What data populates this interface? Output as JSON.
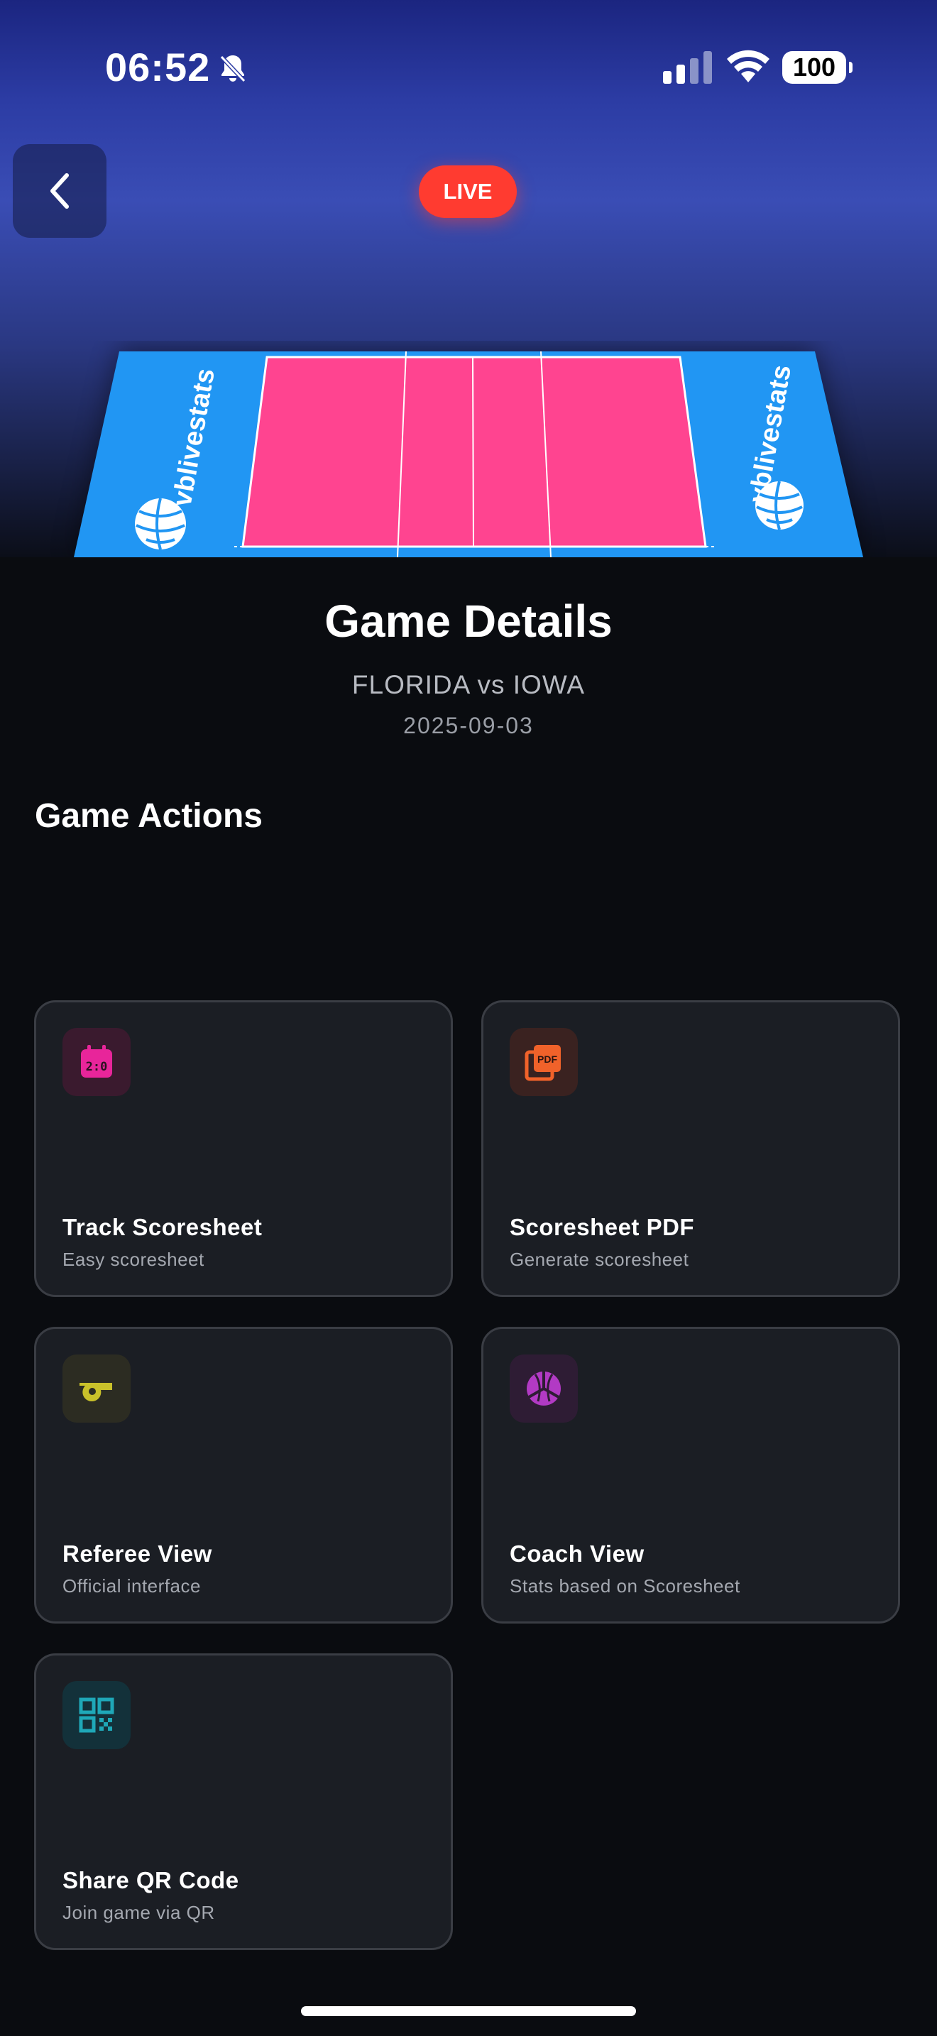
{
  "status_bar": {
    "time": "06:52",
    "battery": "100"
  },
  "header": {
    "live_badge": "LIVE",
    "court_brand": "vblivestats"
  },
  "game": {
    "title": "Game Details",
    "matchup": "FLORIDA vs IOWA",
    "date": "2025-09-03"
  },
  "actions_section": {
    "title": "Game Actions"
  },
  "actions": [
    {
      "title": "Track Scoresheet",
      "subtitle": "Easy scoresheet",
      "icon": "scoreboard-icon",
      "color": "#e8259a"
    },
    {
      "title": "Scoresheet PDF",
      "subtitle": "Generate scoresheet",
      "icon": "pdf-icon",
      "color": "#f0622a"
    },
    {
      "title": "Referee View",
      "subtitle": "Official interface",
      "icon": "whistle-icon",
      "color": "#c9c12a"
    },
    {
      "title": "Coach View",
      "subtitle": "Stats based on Scoresheet",
      "icon": "volleyball-icon",
      "color": "#b23ac4"
    },
    {
      "title": "Share QR Code",
      "subtitle": "Join game via QR",
      "icon": "qr-code-icon",
      "color": "#1fa8b8"
    }
  ],
  "colors": {
    "court_outer": "#2196f3",
    "court_inner": "#ff4490",
    "live": "#ff3b30",
    "card_bg": "#1b1e24",
    "page_bg": "#0a0c10"
  }
}
